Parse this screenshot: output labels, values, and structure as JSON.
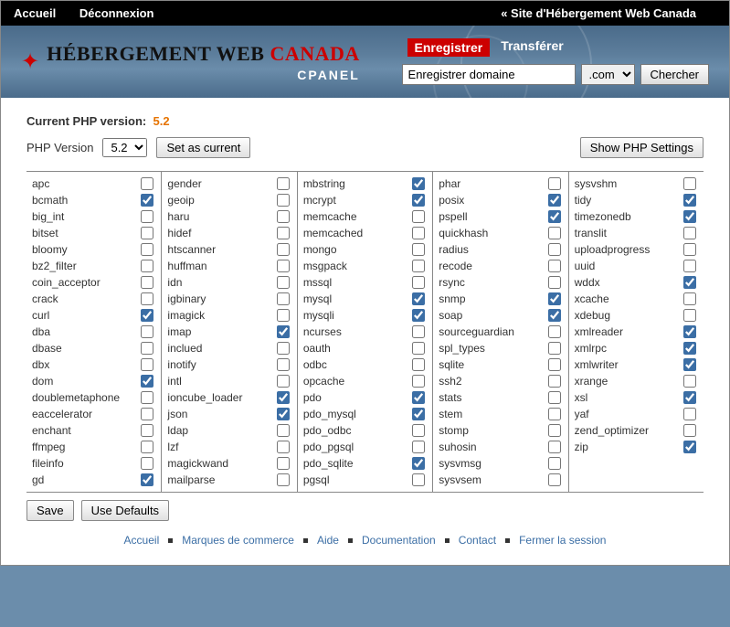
{
  "topbar": {
    "home": "Accueil",
    "logout": "Déconnexion",
    "site_link": "« Site d'Hébergement Web Canada"
  },
  "logo": {
    "brand_prefix": "HÉBERGEMENT WEB",
    "brand_suffix": "CANADA",
    "subtitle": "CPANEL"
  },
  "header": {
    "tab_register": "Enregistrer",
    "tab_transfer": "Transférer",
    "search_placeholder": "Enregistrer domaine",
    "tld": ".com",
    "search_btn": "Chercher"
  },
  "main": {
    "cur_label": "Current PHP version:",
    "cur_version": "5.2",
    "php_version_label": "PHP Version",
    "php_version_select": "5.2",
    "set_current_btn": "Set as current",
    "show_settings_btn": "Show PHP Settings",
    "save_btn": "Save",
    "defaults_btn": "Use Defaults"
  },
  "extensions": [
    [
      {
        "name": "apc",
        "checked": false
      },
      {
        "name": "bcmath",
        "checked": true
      },
      {
        "name": "big_int",
        "checked": false
      },
      {
        "name": "bitset",
        "checked": false
      },
      {
        "name": "bloomy",
        "checked": false
      },
      {
        "name": "bz2_filter",
        "checked": false
      },
      {
        "name": "coin_acceptor",
        "checked": false
      },
      {
        "name": "crack",
        "checked": false
      },
      {
        "name": "curl",
        "checked": true
      },
      {
        "name": "dba",
        "checked": false
      },
      {
        "name": "dbase",
        "checked": false
      },
      {
        "name": "dbx",
        "checked": false
      },
      {
        "name": "dom",
        "checked": true
      },
      {
        "name": "doublemetaphone",
        "checked": false
      },
      {
        "name": "eaccelerator",
        "checked": false
      },
      {
        "name": "enchant",
        "checked": false
      },
      {
        "name": "ffmpeg",
        "checked": false
      },
      {
        "name": "fileinfo",
        "checked": false
      },
      {
        "name": "gd",
        "checked": true
      }
    ],
    [
      {
        "name": "gender",
        "checked": false
      },
      {
        "name": "geoip",
        "checked": false
      },
      {
        "name": "haru",
        "checked": false
      },
      {
        "name": "hidef",
        "checked": false
      },
      {
        "name": "htscanner",
        "checked": false
      },
      {
        "name": "huffman",
        "checked": false
      },
      {
        "name": "idn",
        "checked": false
      },
      {
        "name": "igbinary",
        "checked": false
      },
      {
        "name": "imagick",
        "checked": false
      },
      {
        "name": "imap",
        "checked": true
      },
      {
        "name": "inclued",
        "checked": false
      },
      {
        "name": "inotify",
        "checked": false
      },
      {
        "name": "intl",
        "checked": false
      },
      {
        "name": "ioncube_loader",
        "checked": true
      },
      {
        "name": "json",
        "checked": true
      },
      {
        "name": "ldap",
        "checked": false
      },
      {
        "name": "lzf",
        "checked": false
      },
      {
        "name": "magickwand",
        "checked": false
      },
      {
        "name": "mailparse",
        "checked": false
      }
    ],
    [
      {
        "name": "mbstring",
        "checked": true
      },
      {
        "name": "mcrypt",
        "checked": true
      },
      {
        "name": "memcache",
        "checked": false
      },
      {
        "name": "memcached",
        "checked": false
      },
      {
        "name": "mongo",
        "checked": false
      },
      {
        "name": "msgpack",
        "checked": false
      },
      {
        "name": "mssql",
        "checked": false
      },
      {
        "name": "mysql",
        "checked": true
      },
      {
        "name": "mysqli",
        "checked": true
      },
      {
        "name": "ncurses",
        "checked": false
      },
      {
        "name": "oauth",
        "checked": false
      },
      {
        "name": "odbc",
        "checked": false
      },
      {
        "name": "opcache",
        "checked": false
      },
      {
        "name": "pdo",
        "checked": true
      },
      {
        "name": "pdo_mysql",
        "checked": true
      },
      {
        "name": "pdo_odbc",
        "checked": false
      },
      {
        "name": "pdo_pgsql",
        "checked": false
      },
      {
        "name": "pdo_sqlite",
        "checked": true
      },
      {
        "name": "pgsql",
        "checked": false
      }
    ],
    [
      {
        "name": "phar",
        "checked": false
      },
      {
        "name": "posix",
        "checked": true
      },
      {
        "name": "pspell",
        "checked": true
      },
      {
        "name": "quickhash",
        "checked": false
      },
      {
        "name": "radius",
        "checked": false
      },
      {
        "name": "recode",
        "checked": false
      },
      {
        "name": "rsync",
        "checked": false
      },
      {
        "name": "snmp",
        "checked": true
      },
      {
        "name": "soap",
        "checked": true
      },
      {
        "name": "sourceguardian",
        "checked": false
      },
      {
        "name": "spl_types",
        "checked": false
      },
      {
        "name": "sqlite",
        "checked": false
      },
      {
        "name": "ssh2",
        "checked": false
      },
      {
        "name": "stats",
        "checked": false
      },
      {
        "name": "stem",
        "checked": false
      },
      {
        "name": "stomp",
        "checked": false
      },
      {
        "name": "suhosin",
        "checked": false
      },
      {
        "name": "sysvmsg",
        "checked": false
      },
      {
        "name": "sysvsem",
        "checked": false
      }
    ],
    [
      {
        "name": "sysvshm",
        "checked": false
      },
      {
        "name": "tidy",
        "checked": true
      },
      {
        "name": "timezonedb",
        "checked": true
      },
      {
        "name": "translit",
        "checked": false
      },
      {
        "name": "uploadprogress",
        "checked": false
      },
      {
        "name": "uuid",
        "checked": false
      },
      {
        "name": "wddx",
        "checked": true
      },
      {
        "name": "xcache",
        "checked": false
      },
      {
        "name": "xdebug",
        "checked": false
      },
      {
        "name": "xmlreader",
        "checked": true
      },
      {
        "name": "xmlrpc",
        "checked": true
      },
      {
        "name": "xmlwriter",
        "checked": true
      },
      {
        "name": "xrange",
        "checked": false
      },
      {
        "name": "xsl",
        "checked": true
      },
      {
        "name": "yaf",
        "checked": false
      },
      {
        "name": "zend_optimizer",
        "checked": false
      },
      {
        "name": "zip",
        "checked": true
      }
    ]
  ],
  "footer": {
    "links": [
      "Accueil",
      "Marques de commerce",
      "Aide",
      "Documentation",
      "Contact",
      "Fermer la session"
    ]
  }
}
